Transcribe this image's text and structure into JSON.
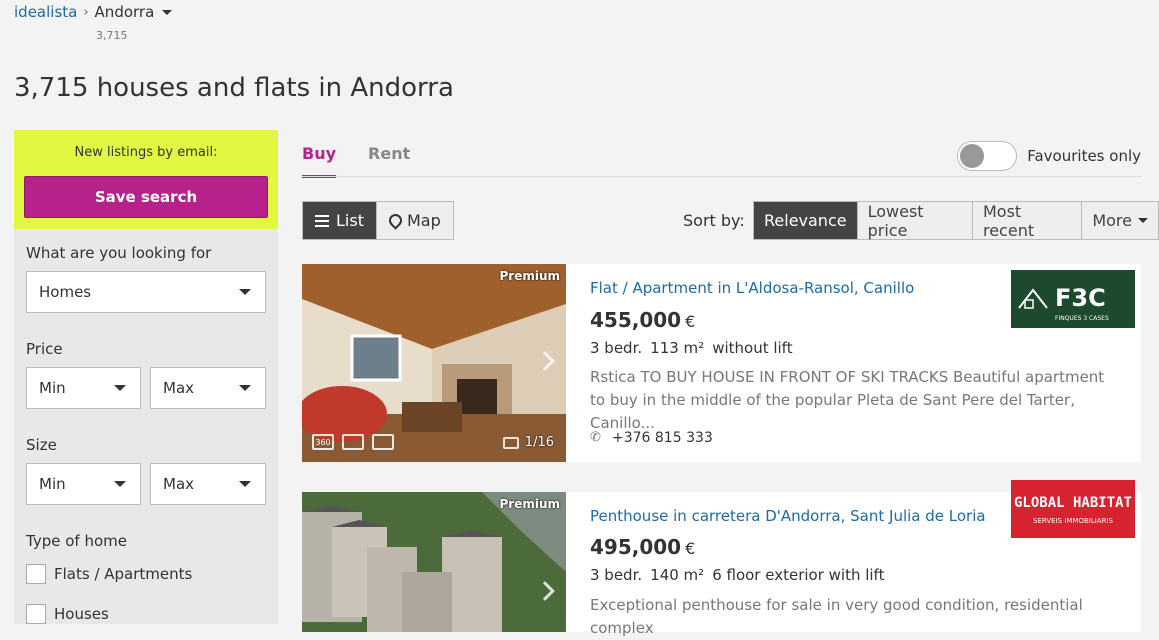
{
  "breadcrumb": {
    "root": "idealista",
    "current": "Andorra",
    "count": "3,715"
  },
  "page_title": "3,715 houses and flats in Andorra",
  "sidebar": {
    "alert_label": "New listings by email:",
    "save_search_label": "Save search",
    "looking_for_label": "What are you looking for",
    "looking_for_value": "Homes",
    "price_label": "Price",
    "size_label": "Size",
    "min_label": "Min",
    "max_label": "Max",
    "type_label": "Type of home",
    "type_options": [
      "Flats / Apartments",
      "Houses"
    ]
  },
  "tabs": [
    "Buy",
    "Rent"
  ],
  "favourites_label": "Favourites only",
  "view": {
    "list_label": "List",
    "map_label": "Map"
  },
  "sort": {
    "label": "Sort by:",
    "options": [
      "Relevance",
      "Lowest price",
      "Most recent",
      "More"
    ]
  },
  "listings": [
    {
      "badge": "Premium",
      "title": "Flat / Apartment in L'Aldosa-Ransol, Canillo",
      "price": "455,000",
      "currency": "€",
      "details": [
        "3 bedr.",
        "113 m²",
        "without lift"
      ],
      "description": "Rstica TO BUY HOUSE IN FRONT OF SKI TRACKS Beautiful apartment to buy in the middle of the popular Pleta de Sant Pere del Tarter, Canillo...",
      "phone": "+376 815 333",
      "photo_count": "1/16",
      "img_icons": [
        "360",
        "video",
        "plan"
      ],
      "logo_text": "F3C",
      "logo_sub": "FINQUES 3 CASES"
    },
    {
      "badge": "Premium",
      "title": "Penthouse in carretera D'Andorra, Sant Julia de Loria",
      "price": "495,000",
      "currency": "€",
      "details": [
        "3 bedr.",
        "140 m²",
        "6 floor exterior with lift"
      ],
      "description": "Exceptional penthouse for sale in very good condition, residential complex",
      "logo_text": "GLOBAL HABITAT",
      "logo_sub": "SERVEIS IMMOBILIARIS"
    }
  ]
}
